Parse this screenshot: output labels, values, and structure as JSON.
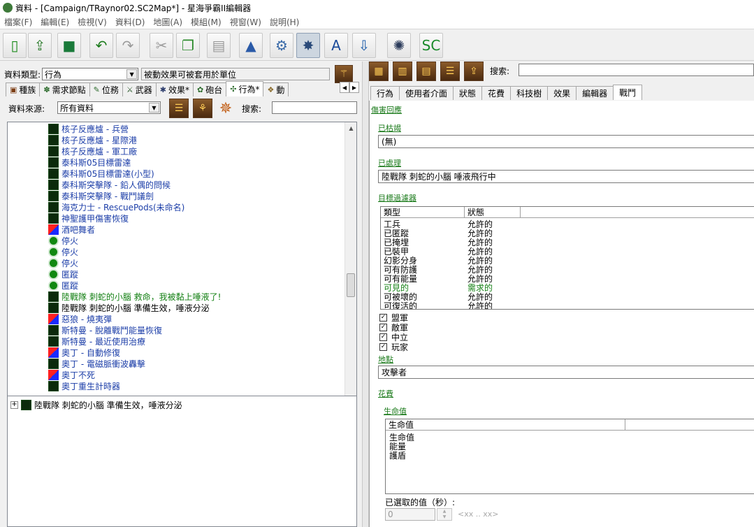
{
  "window": {
    "title": "資料 - [Campaign/TRaynor02.SC2Map*] - 星海爭霸II編輯器"
  },
  "menu": [
    "檔案(F)",
    "編輯(E)",
    "檢視(V)",
    "資料(D)",
    "地圖(A)",
    "模組(M)",
    "視窗(W)",
    "說明(H)"
  ],
  "toolbar": [
    {
      "name": "new-file-icon",
      "glyph": "▯",
      "color": "#1a8a1a"
    },
    {
      "name": "open-file-icon",
      "glyph": "⇪",
      "color": "#2a7a2a"
    },
    {
      "name": "save-icon",
      "glyph": "■",
      "color": "#1a7a3a"
    },
    {
      "name": "undo-icon",
      "glyph": "↶",
      "color": "#1a7a1a"
    },
    {
      "name": "redo-icon",
      "glyph": "↷",
      "color": "#9a9a9a"
    },
    {
      "name": "cut-icon",
      "glyph": "✂",
      "color": "#9a9a9a"
    },
    {
      "name": "copy-icon",
      "glyph": "❐",
      "color": "#2a8a2a"
    },
    {
      "name": "paste-icon",
      "glyph": "▤",
      "color": "#9a9a9a"
    },
    {
      "name": "terrain-editor-icon",
      "glyph": "▲",
      "color": "#2a5aa8"
    },
    {
      "name": "trigger-editor-icon",
      "glyph": "⚙",
      "color": "#3a6aa8"
    },
    {
      "name": "data-editor-icon",
      "glyph": "✸",
      "color": "#2a4a7a"
    },
    {
      "name": "text-editor-icon",
      "glyph": "A",
      "color": "#1a4a9a"
    },
    {
      "name": "import-editor-icon",
      "glyph": "⇩",
      "color": "#1a5aa8"
    },
    {
      "name": "cutscene-editor-icon",
      "glyph": "✺",
      "color": "#2a3a5a"
    },
    {
      "name": "test-map-icon",
      "glyph": "SC",
      "color": "#1a8a2a"
    }
  ],
  "left": {
    "data_type_label": "資料類型:",
    "data_type_value": "行為",
    "data_type_desc": "被動效果可被套用於單位",
    "tabs": [
      {
        "label": "種族",
        "icon": "race-icon"
      },
      {
        "label": "需求節點",
        "icon": "requirement-node-icon"
      },
      {
        "label": "位務",
        "icon": "mover-icon"
      },
      {
        "label": "武器",
        "icon": "weapon-icon"
      },
      {
        "label": "效果*",
        "icon": "effect-icon"
      },
      {
        "label": "砲台",
        "icon": "turret-icon"
      },
      {
        "label": "行為*",
        "icon": "behavior-icon"
      },
      {
        "label": "動",
        "icon": "actor-icon"
      }
    ],
    "source_label": "資料來源:",
    "source_value": "所有資料",
    "search_label": "搜索:",
    "search_value": "",
    "tree_items": [
      {
        "text": "核子反應爐 - 兵營",
        "icon": "dk",
        "style": ""
      },
      {
        "text": "核子反應爐 - 星際港",
        "icon": "dk",
        "style": ""
      },
      {
        "text": "核子反應爐 - 軍工廠",
        "icon": "dk",
        "style": ""
      },
      {
        "text": "泰科斯05目標雷達",
        "icon": "dk",
        "style": ""
      },
      {
        "text": "泰科斯05目標雷達(小型)",
        "icon": "dk",
        "style": ""
      },
      {
        "text": "泰科斯突擊隊 - 鉛人偶的問候",
        "icon": "dk",
        "style": ""
      },
      {
        "text": "泰科斯突擊隊 - 戰鬥議劍",
        "icon": "dk",
        "style": ""
      },
      {
        "text": "海克力士 - RescuePods(未命名)",
        "icon": "dk",
        "style": ""
      },
      {
        "text": "神聖護甲傷害恢復",
        "icon": "dk",
        "style": ""
      },
      {
        "text": "酒吧舞者",
        "icon": "rb",
        "style": ""
      },
      {
        "text": "停火",
        "icon": "gc",
        "style": ""
      },
      {
        "text": "停火",
        "icon": "gc",
        "style": ""
      },
      {
        "text": "停火",
        "icon": "gc",
        "style": ""
      },
      {
        "text": "匿蹤",
        "icon": "gc",
        "style": ""
      },
      {
        "text": "匿蹤",
        "icon": "gc",
        "style": ""
      },
      {
        "text": "陸戰隊 刺蛇的小腦 救命，我被黏上唾液了!",
        "icon": "dk",
        "style": "green"
      },
      {
        "text": "陸戰隊 刺蛇的小腦 準備生效，唾液分泌",
        "icon": "dk",
        "style": "black"
      },
      {
        "text": "惡狼 - 燒夷彈",
        "icon": "rb",
        "style": ""
      },
      {
        "text": "斯特曼 - 脫離戰鬥能量恢復",
        "icon": "dk",
        "style": ""
      },
      {
        "text": "斯特曼 - 最近使用治療",
        "icon": "dk",
        "style": ""
      },
      {
        "text": "奧丁 - 自動修復",
        "icon": "rb",
        "style": ""
      },
      {
        "text": "奧丁 - 電磁脈衝波轟擊",
        "icon": "dk",
        "style": ""
      },
      {
        "text": "奧丁不死",
        "icon": "rb",
        "style": ""
      },
      {
        "text": "奧丁重生計時器",
        "icon": "dk",
        "style": ""
      }
    ],
    "detail_root": "陸戰隊 刺蛇的小腦 準備生效，唾液分泌"
  },
  "right": {
    "search_label": "搜索:",
    "search_value": "",
    "tabs": [
      "行為",
      "使用者介面",
      "狀態",
      "花費",
      "科技樹",
      "效果",
      "編輯器",
      "戰鬥"
    ],
    "active_tab": "戰鬥",
    "fields": {
      "damage_response_label": "傷害回應",
      "exhausted_label": "已枯竭",
      "exhausted_value": "(無)",
      "processed_label": "已處理",
      "processed_value": "陸戰隊 刺蛇的小腦 唾液飛行中",
      "target_filter_label": "目標過濾器",
      "filter_columns": [
        "類型",
        "狀態"
      ],
      "filter_rows": [
        {
          "type": "工兵",
          "state": "允許的",
          "green": false
        },
        {
          "type": "已匿蹤",
          "state": "允許的",
          "green": false
        },
        {
          "type": "已掩埋",
          "state": "允許的",
          "green": false
        },
        {
          "type": "已裝甲",
          "state": "允許的",
          "green": false
        },
        {
          "type": "幻影分身",
          "state": "允許的",
          "green": false
        },
        {
          "type": "可有防護",
          "state": "允許的",
          "green": false
        },
        {
          "type": "可有能量",
          "state": "允許的",
          "green": false
        },
        {
          "type": "可見的",
          "state": "需求的",
          "green": true
        },
        {
          "type": "可被壞的",
          "state": "允許的",
          "green": false
        },
        {
          "type": "可復活的",
          "state": "允許的",
          "green": false
        }
      ],
      "checks": [
        {
          "label": "盟軍",
          "checked": true
        },
        {
          "label": "敵軍",
          "checked": true
        },
        {
          "label": "中立",
          "checked": true
        },
        {
          "label": "玩家",
          "checked": true
        }
      ],
      "location_label": "地點",
      "location_value": "攻擊者",
      "cost_label": "花費",
      "vital_label": "生命值",
      "vital_column": "生命值",
      "vital_rows": [
        "生命值",
        "能量",
        "護盾"
      ],
      "selected_value_label": "已選取的值（秒）:",
      "selected_value": "0",
      "selected_value_hint": "<xx .. xx>"
    }
  }
}
